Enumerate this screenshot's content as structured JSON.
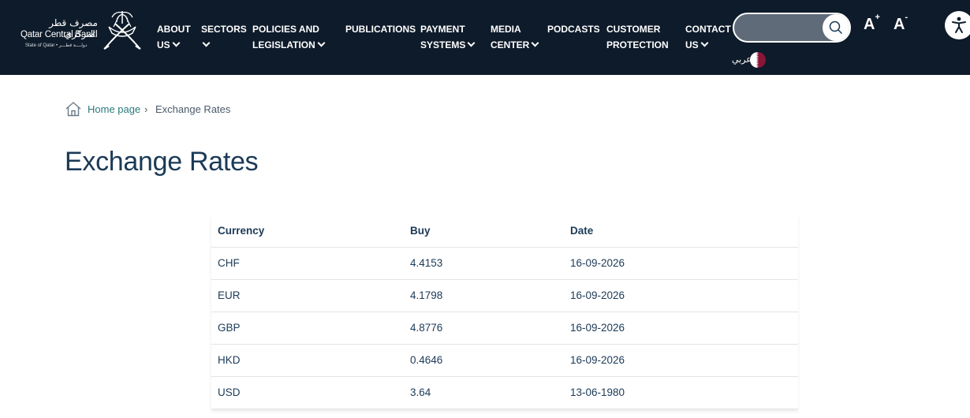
{
  "header": {
    "logo": {
      "arabic_name": "مصرف قطر المركزي",
      "english_name": "Qatar Central Bank",
      "subtitle": "State of Qatar • دولــــة قطـــر"
    },
    "nav": [
      {
        "line1": "ABOUT",
        "line2": "US",
        "has_dropdown": true
      },
      {
        "line1": "SECTORS",
        "line2": "",
        "has_dropdown": true
      },
      {
        "line1": "POLICIES AND",
        "line2": "LEGISLATION",
        "has_dropdown": true
      },
      {
        "line1": "PUBLICATIONS",
        "line2": "",
        "has_dropdown": false
      },
      {
        "line1": "PAYMENT",
        "line2": "SYSTEMS",
        "has_dropdown": true
      },
      {
        "line1": "MEDIA",
        "line2": "CENTER",
        "has_dropdown": true
      },
      {
        "line1": "PODCASTS",
        "line2": "",
        "has_dropdown": false
      },
      {
        "line1": "CUSTOMER",
        "line2": "PROTECTION",
        "has_dropdown": false
      },
      {
        "line1": "CONTACT",
        "line2": "US",
        "has_dropdown": true
      }
    ],
    "search": {
      "placeholder": "",
      "icon": "search-icon"
    },
    "font_increase": {
      "label": "A",
      "sup": "+"
    },
    "font_decrease": {
      "label": "A",
      "sup": "-"
    },
    "language": {
      "label": "عربي",
      "icon": "qatar-flag-icon"
    },
    "accessibility": {
      "icon": "accessibility-icon"
    }
  },
  "breadcrumb": {
    "home": "Home page",
    "separator": "›",
    "current": "Exchange Rates"
  },
  "page": {
    "title": "Exchange Rates"
  },
  "rates_table": {
    "headers": [
      "Currency",
      "Buy",
      "Date"
    ],
    "rows": [
      [
        "CHF",
        "4.4153",
        "16-09-2026"
      ],
      [
        "EUR",
        "4.1798",
        "16-09-2026"
      ],
      [
        "GBP",
        "4.8776",
        "16-09-2026"
      ],
      [
        "HKD",
        "0.4646",
        "16-09-2026"
      ],
      [
        "USD",
        "3.64",
        "13-06-1980"
      ]
    ]
  },
  "colors": {
    "header_bg": "#0e1b2a",
    "title_text": "#1b3a57",
    "link": "#2a7a7a",
    "qatar_maroon": "#8a1538"
  }
}
